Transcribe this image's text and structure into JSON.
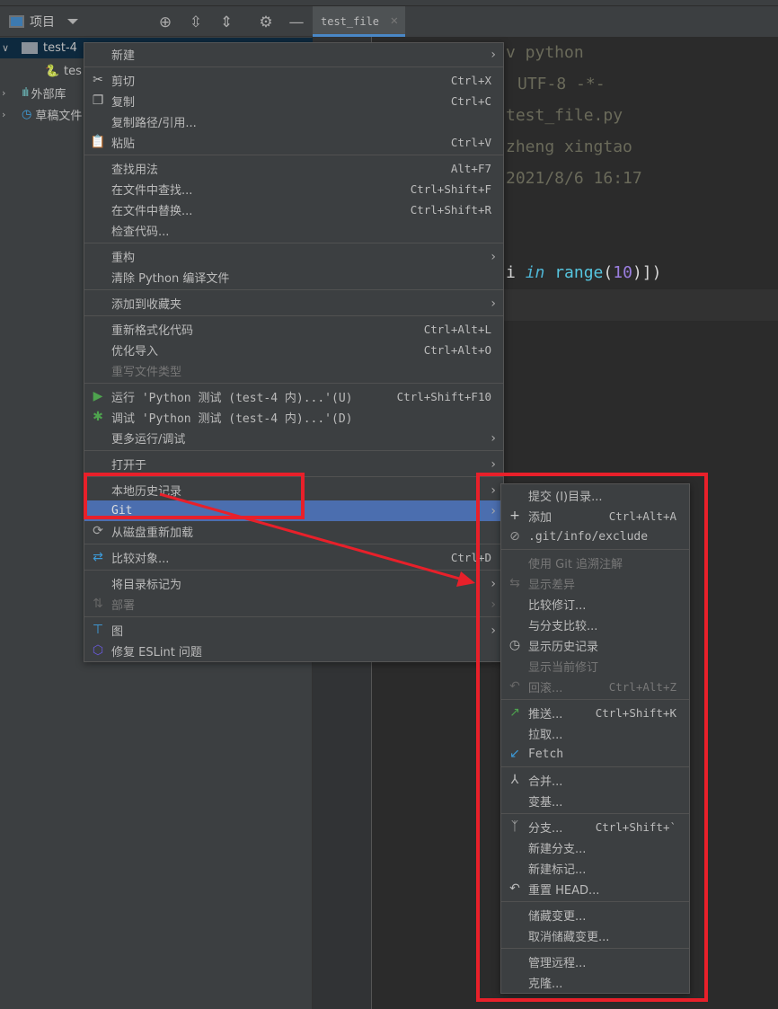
{
  "toolbar": {
    "project_label": "项目",
    "icons": [
      "crosshair-icon",
      "expand-all-icon",
      "collapse-all-icon",
      "gear-icon",
      "minimize-icon"
    ]
  },
  "tab": {
    "label": "test_file"
  },
  "tree": [
    {
      "label": "test-4",
      "icon": "folder-icon",
      "expanded": true,
      "selected": true
    },
    {
      "label": "tes",
      "icon": "python-file-icon"
    },
    {
      "label": "外部库",
      "icon": "library-icon",
      "expanded": false
    },
    {
      "label": "草稿文件",
      "icon": "scratch-icon",
      "expanded": false
    }
  ],
  "code": [
    "v python",
    "UTF-8 -*-",
    "test_file.py",
    "zheng xingtao",
    "2021/8/6 16:17"
  ],
  "code_last": {
    "a": "i ",
    "kw": "in",
    "fn": " range",
    "p1": "(",
    "num": "10",
    "p2": ")])"
  },
  "context_menu": [
    {
      "label": "新建",
      "submenu": true
    },
    {
      "sep": true
    },
    {
      "label": "剪切",
      "shortcut": "Ctrl+X",
      "icon": "scissors-icon"
    },
    {
      "label": "复制",
      "shortcut": "Ctrl+C",
      "icon": "copy-icon"
    },
    {
      "label": "复制路径/引用..."
    },
    {
      "label": "粘贴",
      "shortcut": "Ctrl+V",
      "icon": "paste-icon"
    },
    {
      "sep": true
    },
    {
      "label": "查找用法",
      "shortcut": "Alt+F7"
    },
    {
      "label": "在文件中查找...",
      "shortcut": "Ctrl+Shift+F"
    },
    {
      "label": "在文件中替换...",
      "shortcut": "Ctrl+Shift+R"
    },
    {
      "label": "检查代码..."
    },
    {
      "sep": true
    },
    {
      "label": "重构",
      "submenu": true
    },
    {
      "label": "清除 Python 编译文件"
    },
    {
      "sep": true
    },
    {
      "label": "添加到收藏夹",
      "submenu": true
    },
    {
      "sep": true
    },
    {
      "label": "重新格式化代码",
      "shortcut": "Ctrl+Alt+L"
    },
    {
      "label": "优化导入",
      "shortcut": "Ctrl+Alt+O"
    },
    {
      "label": "重写文件类型",
      "disabled": true
    },
    {
      "sep": true
    },
    {
      "label": "运行 'Python 测试 (test-4 内)...'(U)",
      "shortcut": "Ctrl+Shift+F10",
      "icon": "run-icon"
    },
    {
      "label": "调试 'Python 测试 (test-4 内)...'(D)",
      "icon": "debug-icon"
    },
    {
      "label": "更多运行/调试",
      "submenu": true
    },
    {
      "sep": true
    },
    {
      "label": "打开于",
      "submenu": true
    },
    {
      "sep": true
    },
    {
      "label": "本地历史记录",
      "submenu": true
    },
    {
      "label": "Git",
      "submenu": true,
      "highlighted": true
    },
    {
      "label": "从磁盘重新加载",
      "icon": "reload-icon"
    },
    {
      "sep": true
    },
    {
      "label": "比较对象...",
      "shortcut": "Ctrl+D",
      "icon": "compare-icon"
    },
    {
      "sep": true
    },
    {
      "label": "将目录标记为",
      "submenu": true
    },
    {
      "label": "部署",
      "submenu": true,
      "disabled": true,
      "icon": "deploy-icon"
    },
    {
      "sep": true
    },
    {
      "label": "图",
      "submenu": true,
      "icon": "diagram-icon"
    },
    {
      "label": "修复 ESLint 问题",
      "icon": "eslint-icon"
    }
  ],
  "git_menu": [
    {
      "label": "提交 (I)目录..."
    },
    {
      "label": "添加",
      "shortcut": "Ctrl+Alt+A",
      "icon": "plus-icon"
    },
    {
      "label": ".git/info/exclude",
      "icon": "ignore-file-icon"
    },
    {
      "sep": true
    },
    {
      "label": "使用 Git 追溯注解",
      "disabled": true
    },
    {
      "label": "显示差异",
      "disabled": true,
      "icon": "diff-icon"
    },
    {
      "label": "比较修订..."
    },
    {
      "label": "与分支比较..."
    },
    {
      "label": "显示历史记录",
      "icon": "clock-icon"
    },
    {
      "label": "显示当前修订",
      "disabled": true
    },
    {
      "label": "回滚...",
      "shortcut": "Ctrl+Alt+Z",
      "disabled": true,
      "icon": "rollback-icon"
    },
    {
      "sep": true
    },
    {
      "label": "推送...",
      "shortcut": "Ctrl+Shift+K",
      "icon": "push-icon"
    },
    {
      "label": "拉取..."
    },
    {
      "label": "Fetch",
      "icon": "fetch-icon"
    },
    {
      "sep": true
    },
    {
      "label": "合并...",
      "icon": "merge-icon"
    },
    {
      "label": "变基..."
    },
    {
      "sep": true
    },
    {
      "label": "分支...",
      "shortcut": "Ctrl+Shift+`",
      "icon": "branch-icon"
    },
    {
      "label": "新建分支..."
    },
    {
      "label": "新建标记..."
    },
    {
      "label": "重置 HEAD...",
      "icon": "reset-icon"
    },
    {
      "sep": true
    },
    {
      "label": "储藏变更..."
    },
    {
      "label": "取消储藏变更..."
    },
    {
      "sep": true
    },
    {
      "label": "管理远程..."
    },
    {
      "label": "克隆..."
    }
  ],
  "colors": {
    "highlight": "#4b6eaf",
    "annotation": "#e8202a",
    "menu_bg": "#3c3f41"
  }
}
